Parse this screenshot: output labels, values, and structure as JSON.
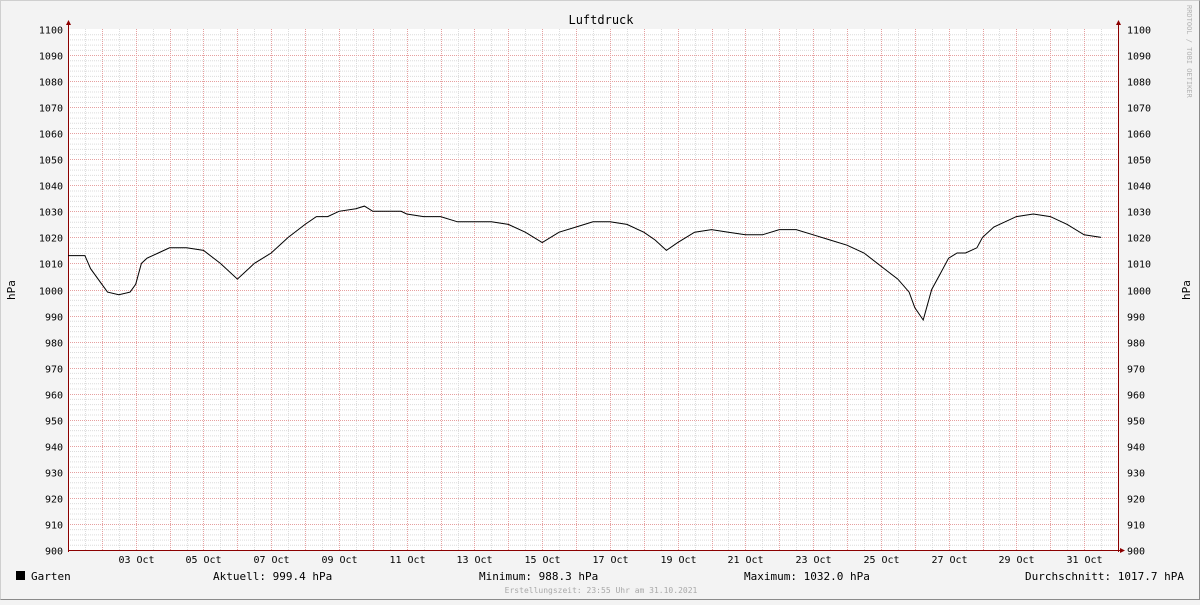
{
  "chart_data": {
    "type": "line",
    "title": "Luftdruck",
    "ylabel": "hPa",
    "ylim": [
      900,
      1100
    ],
    "ytick_step": 10,
    "xlim": [
      "2021-10-01",
      "2021-11-01"
    ],
    "x_ticks": [
      "03 Oct",
      "05 Oct",
      "07 Oct",
      "09 Oct",
      "11 Oct",
      "13 Oct",
      "15 Oct",
      "17 Oct",
      "19 Oct",
      "21 Oct",
      "23 Oct",
      "25 Oct",
      "27 Oct",
      "29 Oct",
      "31 Oct"
    ],
    "grid": true,
    "legend_position": "bottom-left",
    "series": [
      {
        "name": "Garten",
        "color": "#000000",
        "points": [
          [
            "2021-10-01 00:00",
            1013.0
          ],
          [
            "2021-10-01 12:00",
            1013.0
          ],
          [
            "2021-10-01 16:00",
            1008.0
          ],
          [
            "2021-10-02 00:00",
            1002.0
          ],
          [
            "2021-10-02 04:00",
            999.0
          ],
          [
            "2021-10-02 12:00",
            998.0
          ],
          [
            "2021-10-02 20:00",
            999.0
          ],
          [
            "2021-10-03 00:00",
            1002.0
          ],
          [
            "2021-10-03 04:00",
            1010.0
          ],
          [
            "2021-10-03 08:00",
            1012.0
          ],
          [
            "2021-10-03 16:00",
            1014.0
          ],
          [
            "2021-10-04 00:00",
            1016.0
          ],
          [
            "2021-10-04 12:00",
            1016.0
          ],
          [
            "2021-10-05 00:00",
            1015.0
          ],
          [
            "2021-10-05 12:00",
            1010.0
          ],
          [
            "2021-10-06 00:00",
            1004.0
          ],
          [
            "2021-10-06 08:00",
            1008.0
          ],
          [
            "2021-10-06 12:00",
            1010.0
          ],
          [
            "2021-10-07 00:00",
            1014.0
          ],
          [
            "2021-10-07 12:00",
            1020.0
          ],
          [
            "2021-10-08 00:00",
            1025.0
          ],
          [
            "2021-10-08 08:00",
            1028.0
          ],
          [
            "2021-10-08 16:00",
            1028.0
          ],
          [
            "2021-10-09 00:00",
            1030.0
          ],
          [
            "2021-10-09 12:00",
            1031.0
          ],
          [
            "2021-10-09 18:00",
            1032.0
          ],
          [
            "2021-10-10 00:00",
            1030.0
          ],
          [
            "2021-10-10 12:00",
            1030.0
          ],
          [
            "2021-10-10 20:00",
            1030.0
          ],
          [
            "2021-10-11 00:00",
            1029.0
          ],
          [
            "2021-10-11 12:00",
            1028.0
          ],
          [
            "2021-10-12 00:00",
            1028.0
          ],
          [
            "2021-10-12 12:00",
            1026.0
          ],
          [
            "2021-10-13 00:00",
            1026.0
          ],
          [
            "2021-10-13 12:00",
            1026.0
          ],
          [
            "2021-10-14 00:00",
            1025.0
          ],
          [
            "2021-10-14 12:00",
            1022.0
          ],
          [
            "2021-10-15 00:00",
            1018.0
          ],
          [
            "2021-10-15 12:00",
            1022.0
          ],
          [
            "2021-10-16 00:00",
            1024.0
          ],
          [
            "2021-10-16 12:00",
            1026.0
          ],
          [
            "2021-10-17 00:00",
            1026.0
          ],
          [
            "2021-10-17 12:00",
            1025.0
          ],
          [
            "2021-10-18 00:00",
            1022.0
          ],
          [
            "2021-10-18 08:00",
            1019.0
          ],
          [
            "2021-10-18 16:00",
            1015.0
          ],
          [
            "2021-10-19 00:00",
            1018.0
          ],
          [
            "2021-10-19 12:00",
            1022.0
          ],
          [
            "2021-10-20 00:00",
            1023.0
          ],
          [
            "2021-10-20 12:00",
            1022.0
          ],
          [
            "2021-10-21 00:00",
            1021.0
          ],
          [
            "2021-10-21 12:00",
            1021.0
          ],
          [
            "2021-10-22 00:00",
            1023.0
          ],
          [
            "2021-10-22 12:00",
            1023.0
          ],
          [
            "2021-10-23 00:00",
            1021.0
          ],
          [
            "2021-10-23 12:00",
            1019.0
          ],
          [
            "2021-10-24 00:00",
            1017.0
          ],
          [
            "2021-10-24 12:00",
            1014.0
          ],
          [
            "2021-10-25 00:00",
            1009.0
          ],
          [
            "2021-10-25 12:00",
            1004.0
          ],
          [
            "2021-10-25 20:00",
            999.0
          ],
          [
            "2021-10-26 00:00",
            993.0
          ],
          [
            "2021-10-26 06:00",
            988.3
          ],
          [
            "2021-10-26 12:00",
            1000.0
          ],
          [
            "2021-10-26 18:00",
            1006.0
          ],
          [
            "2021-10-27 00:00",
            1012.0
          ],
          [
            "2021-10-27 06:00",
            1014.0
          ],
          [
            "2021-10-27 12:00",
            1014.0
          ],
          [
            "2021-10-27 20:00",
            1016.0
          ],
          [
            "2021-10-28 00:00",
            1020.0
          ],
          [
            "2021-10-28 08:00",
            1024.0
          ],
          [
            "2021-10-28 16:00",
            1026.0
          ],
          [
            "2021-10-29 00:00",
            1028.0
          ],
          [
            "2021-10-29 12:00",
            1029.0
          ],
          [
            "2021-10-30 00:00",
            1028.0
          ],
          [
            "2021-10-30 12:00",
            1025.0
          ],
          [
            "2021-10-31 00:00",
            1021.0
          ],
          [
            "2021-10-31 12:00",
            1020.0
          ]
        ]
      }
    ]
  },
  "legend": {
    "series_name": "Garten",
    "current": "Aktuell: 999.4 hPa",
    "minimum": "Minimum: 988.3 hPa",
    "maximum": "Maximum: 1032.0 hPa",
    "average": "Durchschnitt: 1017.7 hPA"
  },
  "footer": "Erstellungszeit: 23:55 Uhr am 31.10.2021",
  "watermark": "RRDTOOL / TOBI OETIKER",
  "colors": {
    "background": "#f3f3f3",
    "canvas": "#ffffff",
    "major_grid": "#e6a0a0",
    "minor_grid": "#dcdcdc",
    "axis": "#8b0000",
    "line": "#000000"
  }
}
